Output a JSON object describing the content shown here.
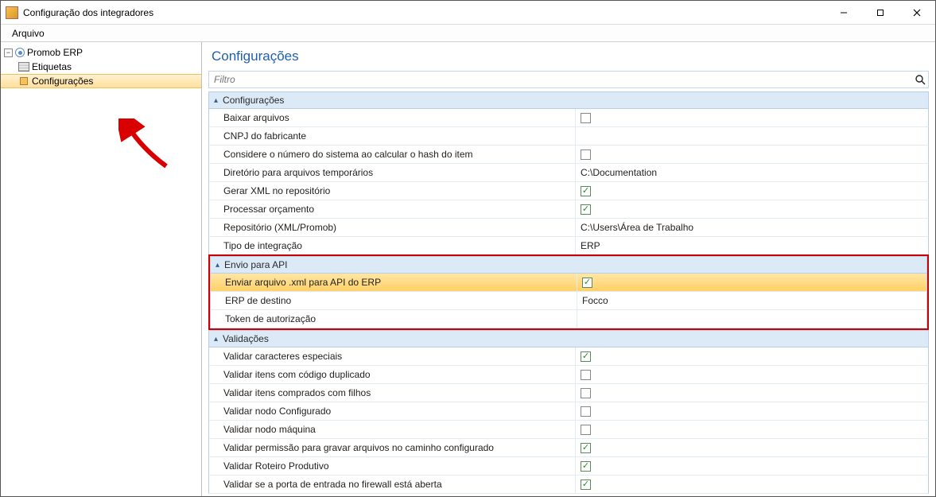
{
  "window": {
    "title": "Configuração dos integradores"
  },
  "menubar": {
    "items": [
      {
        "label": "Arquivo"
      }
    ]
  },
  "sidebar": {
    "root": {
      "label": "Promob ERP"
    },
    "items": [
      {
        "label": "Etiquetas"
      },
      {
        "label": "Configurações"
      }
    ]
  },
  "main": {
    "title": "Configurações",
    "filter_placeholder": "Filtro"
  },
  "categories": [
    {
      "name": "Configurações",
      "rows": [
        {
          "label": "Baixar arquivos",
          "type": "check",
          "checked": false
        },
        {
          "label": "CNPJ do fabricante",
          "type": "text",
          "value": ""
        },
        {
          "label": "Considere o número do sistema ao calcular o hash do item",
          "type": "check",
          "checked": false
        },
        {
          "label": "Diretório para arquivos temporários",
          "type": "text",
          "value": "C:\\Documentation"
        },
        {
          "label": "Gerar XML no repositório",
          "type": "check",
          "checked": true
        },
        {
          "label": "Processar orçamento",
          "type": "check",
          "checked": true
        },
        {
          "label": "Repositório (XML/Promob)",
          "type": "text",
          "value": "C:\\Users\\Área de Trabalho"
        },
        {
          "label": "Tipo de integração",
          "type": "text",
          "value": "ERP"
        }
      ]
    },
    {
      "name": "Envio para API",
      "highlighted": true,
      "rows": [
        {
          "label": "Enviar arquivo .xml para API do ERP",
          "type": "check",
          "checked": true,
          "rowHighlight": true
        },
        {
          "label": "ERP de destino",
          "type": "text",
          "value": "Focco"
        },
        {
          "label": "Token de autorização",
          "type": "text",
          "value": ""
        }
      ]
    },
    {
      "name": "Validações",
      "rows": [
        {
          "label": "Validar caracteres especiais",
          "type": "check",
          "checked": true
        },
        {
          "label": "Validar itens com código duplicado",
          "type": "check",
          "checked": false
        },
        {
          "label": "Validar itens comprados com filhos",
          "type": "check",
          "checked": false
        },
        {
          "label": "Validar nodo Configurado",
          "type": "check",
          "checked": false
        },
        {
          "label": "Validar nodo máquina",
          "type": "check",
          "checked": false
        },
        {
          "label": "Validar permissão para gravar arquivos no caminho configurado",
          "type": "check",
          "checked": true
        },
        {
          "label": "Validar Roteiro Produtivo",
          "type": "check",
          "checked": true
        },
        {
          "label": "Validar se a porta de entrada no firewall está aberta",
          "type": "check",
          "checked": true
        }
      ]
    }
  ]
}
